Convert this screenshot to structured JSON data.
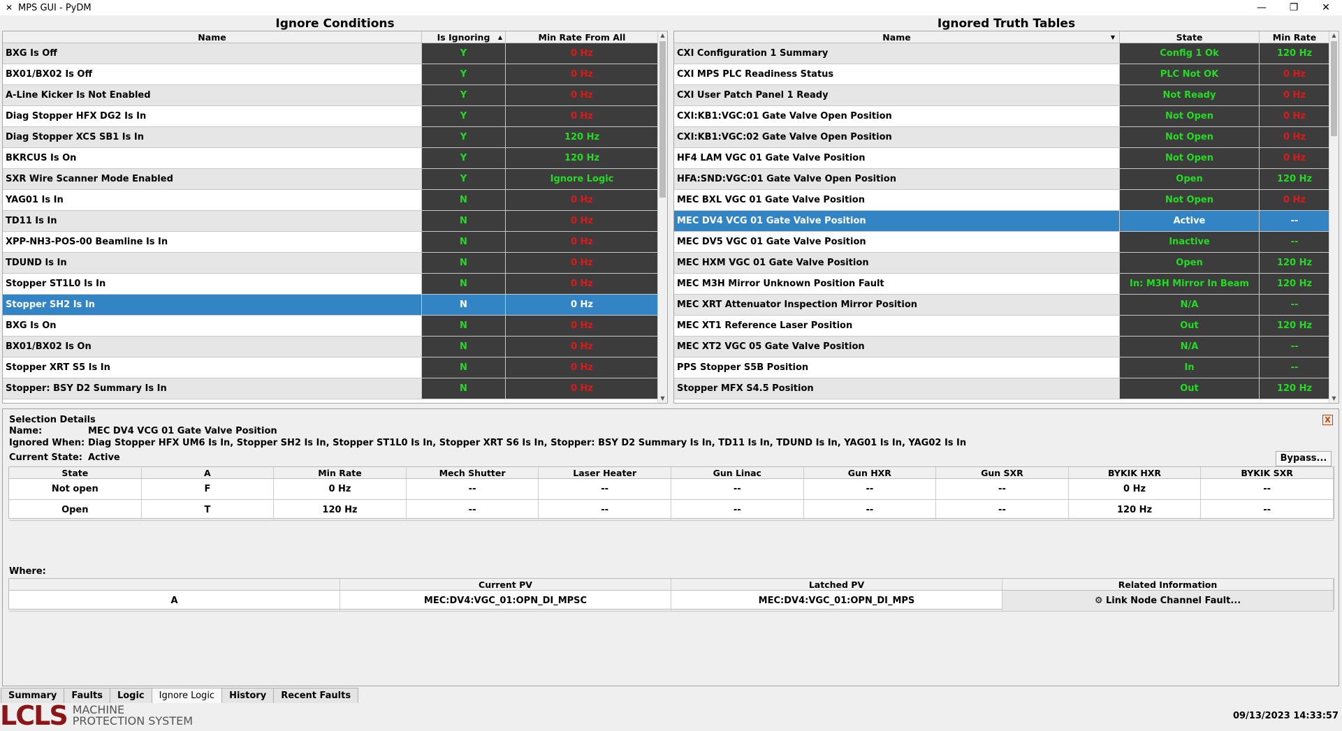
{
  "window": {
    "title": "MPS GUI - PyDM"
  },
  "left": {
    "title": "Ignore Conditions",
    "columns": [
      "Name",
      "Is Ignoring",
      "Min Rate From All"
    ],
    "rows": [
      {
        "name": "BXG Is Off",
        "ignoring": "Y",
        "rate": "0 Hz",
        "rate_ok": false
      },
      {
        "name": "BX01/BX02 Is Off",
        "ignoring": "Y",
        "rate": "0 Hz",
        "rate_ok": false
      },
      {
        "name": "A-Line Kicker Is Not Enabled",
        "ignoring": "Y",
        "rate": "0 Hz",
        "rate_ok": false
      },
      {
        "name": "Diag Stopper HFX DG2 Is In",
        "ignoring": "Y",
        "rate": "0 Hz",
        "rate_ok": false
      },
      {
        "name": "Diag Stopper XCS SB1 Is In",
        "ignoring": "Y",
        "rate": "120 Hz",
        "rate_ok": true
      },
      {
        "name": "BKRCUS Is On",
        "ignoring": "Y",
        "rate": "120 Hz",
        "rate_ok": true
      },
      {
        "name": "SXR Wire Scanner Mode Enabled",
        "ignoring": "Y",
        "rate": "Ignore Logic",
        "rate_ok": true
      },
      {
        "name": "YAG01 Is In",
        "ignoring": "N",
        "rate": "0 Hz",
        "rate_ok": false
      },
      {
        "name": "TD11 Is In",
        "ignoring": "N",
        "rate": "0 Hz",
        "rate_ok": false
      },
      {
        "name": "XPP-NH3-POS-00 Beamline Is In",
        "ignoring": "N",
        "rate": "0 Hz",
        "rate_ok": false
      },
      {
        "name": "TDUND Is In",
        "ignoring": "N",
        "rate": "0 Hz",
        "rate_ok": false
      },
      {
        "name": "Stopper ST1L0 Is In",
        "ignoring": "N",
        "rate": "0 Hz",
        "rate_ok": false
      },
      {
        "name": "Stopper SH2 Is In",
        "ignoring": "N",
        "rate": "0 Hz",
        "rate_ok": false,
        "selected": true
      },
      {
        "name": "BXG Is On",
        "ignoring": "N",
        "rate": "0 Hz",
        "rate_ok": false
      },
      {
        "name": "BX01/BX02 Is On",
        "ignoring": "N",
        "rate": "0 Hz",
        "rate_ok": false
      },
      {
        "name": "Stopper XRT S5 Is In",
        "ignoring": "N",
        "rate": "0 Hz",
        "rate_ok": false
      },
      {
        "name": "Stopper: BSY D2 Summary Is In",
        "ignoring": "N",
        "rate": "0 Hz",
        "rate_ok": false
      }
    ]
  },
  "right": {
    "title": "Ignored Truth Tables",
    "columns": [
      "Name",
      "State",
      "Min Rate"
    ],
    "rows": [
      {
        "name": "CXI Configuration 1 Summary",
        "state": "Config 1 Ok",
        "rate": "120 Hz",
        "rate_ok": true
      },
      {
        "name": "CXI MPS PLC Readiness Status",
        "state": "PLC Not OK",
        "rate": "0 Hz",
        "rate_ok": false
      },
      {
        "name": "CXI User Patch Panel 1 Ready",
        "state": "Not Ready",
        "rate": "0 Hz",
        "rate_ok": false
      },
      {
        "name": "CXI:KB1:VGC:01 Gate Valve Open Position",
        "state": "Not Open",
        "rate": "0 Hz",
        "rate_ok": false
      },
      {
        "name": "CXI:KB1:VGC:02 Gate Valve Open Position",
        "state": "Not Open",
        "rate": "0 Hz",
        "rate_ok": false
      },
      {
        "name": "HF4 LAM VGC 01 Gate Valve Position",
        "state": "Not Open",
        "rate": "0 Hz",
        "rate_ok": false
      },
      {
        "name": "HFA:SND:VGC:01 Gate Valve Open Position",
        "state": "Open",
        "rate": "120 Hz",
        "rate_ok": true
      },
      {
        "name": "MEC BXL VGC 01 Gate Valve Position",
        "state": "Not Open",
        "rate": "0 Hz",
        "rate_ok": false
      },
      {
        "name": "MEC DV4 VCG 01 Gate Valve Position",
        "state": "Active",
        "rate": "--",
        "rate_ok": true,
        "selected": true
      },
      {
        "name": "MEC DV5 VGC 01 Gate Valve Position",
        "state": "Inactive",
        "rate": "--",
        "rate_ok": true
      },
      {
        "name": "MEC HXM VGC 01 Gate Valve Position",
        "state": "Open",
        "rate": "120 Hz",
        "rate_ok": true
      },
      {
        "name": "MEC M3H Mirror Unknown Position Fault",
        "state": "In: M3H Mirror In Beam",
        "rate": "120 Hz",
        "rate_ok": true
      },
      {
        "name": "MEC XRT Attenuator Inspection Mirror Position",
        "state": "N/A",
        "rate": "--",
        "rate_ok": true
      },
      {
        "name": "MEC XT1 Reference Laser Position",
        "state": "Out",
        "rate": "120 Hz",
        "rate_ok": true
      },
      {
        "name": "MEC XT2 VGC 05 Gate Valve Position",
        "state": "N/A",
        "rate": "--",
        "rate_ok": true
      },
      {
        "name": "PPS Stopper S5B Position",
        "state": "In",
        "rate": "--",
        "rate_ok": true
      },
      {
        "name": "Stopper MFX S4.5 Position",
        "state": "Out",
        "rate": "120 Hz",
        "rate_ok": true
      }
    ]
  },
  "details": {
    "title": "Selection Details",
    "close_label": "X",
    "name_label": "Name:",
    "name_value": "MEC DV4 VCG 01 Gate Valve Position",
    "ignored_label": "Ignored When:",
    "ignored_value": "Diag Stopper HFX UM6 Is In, Stopper SH2 Is In, Stopper ST1L0 Is In, Stopper XRT S6 Is In, Stopper: BSY D2 Summary Is In, TD11 Is In, TDUND Is In, YAG01 Is In, YAG02 Is In",
    "state_label": "Current State:",
    "state_value": "Active",
    "bypass_label": "Bypass...",
    "truth_columns": [
      "State",
      "A",
      "Min Rate",
      "Mech Shutter",
      "Laser Heater",
      "Gun Linac",
      "Gun HXR",
      "Gun SXR",
      "BYKIK HXR",
      "BYKIK SXR"
    ],
    "truth_rows": [
      [
        "Not open",
        "F",
        "0 Hz",
        "--",
        "--",
        "--",
        "--",
        "--",
        "0 Hz",
        "--"
      ],
      [
        "Open",
        "T",
        "120 Hz",
        "--",
        "--",
        "--",
        "--",
        "--",
        "120 Hz",
        "--"
      ]
    ],
    "where_label": "Where:",
    "where_columns": [
      "",
      "Current PV",
      "Latched PV",
      "Related Information"
    ],
    "where_rows": [
      [
        "A",
        "MEC:DV4:VGC_01:OPN_DI_MPSC",
        "MEC:DV4:VGC_01:OPN_DI_MPS",
        "Link Node Channel Fault..."
      ]
    ]
  },
  "tabs": [
    {
      "label": "Summary",
      "active": false
    },
    {
      "label": "Faults",
      "active": false
    },
    {
      "label": "Logic",
      "active": false
    },
    {
      "label": "Ignore Logic",
      "active": true
    },
    {
      "label": "History",
      "active": false
    },
    {
      "label": "Recent Faults",
      "active": false
    }
  ],
  "footer": {
    "logo_text": "LCLS",
    "logo_line1": "MACHINE",
    "logo_line2": "PROTECTION SYSTEM",
    "timestamp": "09/13/2023 14:33:57"
  },
  "colors": {
    "ok": "#22dd22",
    "fault": "#e01818",
    "selected": "#3284c4",
    "dark_cell": "#3c3c3c"
  }
}
